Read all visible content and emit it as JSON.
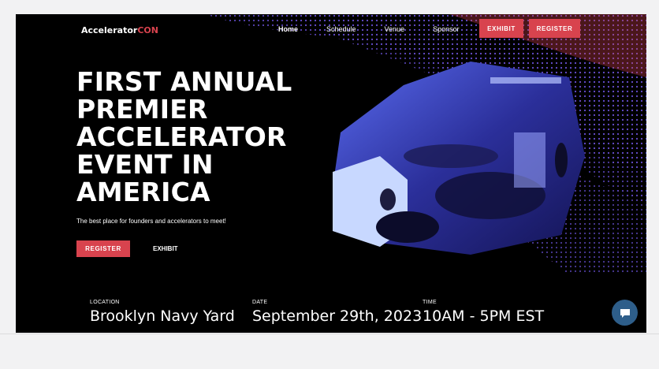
{
  "brand": {
    "part1": "Accelerator",
    "part2": "CON"
  },
  "nav": {
    "items": [
      "Home",
      "Schedule",
      "Venue",
      "Sponsor"
    ],
    "exhibit": "EXHIBIT",
    "register": "REGISTER"
  },
  "hero": {
    "headline_lines": [
      "FIRST ANNUAL",
      "PREMIER",
      "ACCELERATOR",
      "EVENT IN",
      "AMERICA"
    ],
    "tagline": "The best place for founders and accelerators to meet!",
    "register": "REGISTER",
    "exhibit": "EXHIBIT"
  },
  "info": {
    "location_label": "LOCATION",
    "location": "Brooklyn Navy Yard",
    "date_label": "DATE",
    "date": "September 29th, 2023",
    "time_label": "TIME",
    "time": "10AM - 5PM EST"
  },
  "colors": {
    "accent": "#d8434e",
    "wave_blue": "#3a4bd8",
    "chat": "#2e5e8a"
  },
  "icons": {
    "chat": "chat-bubble-icon"
  }
}
